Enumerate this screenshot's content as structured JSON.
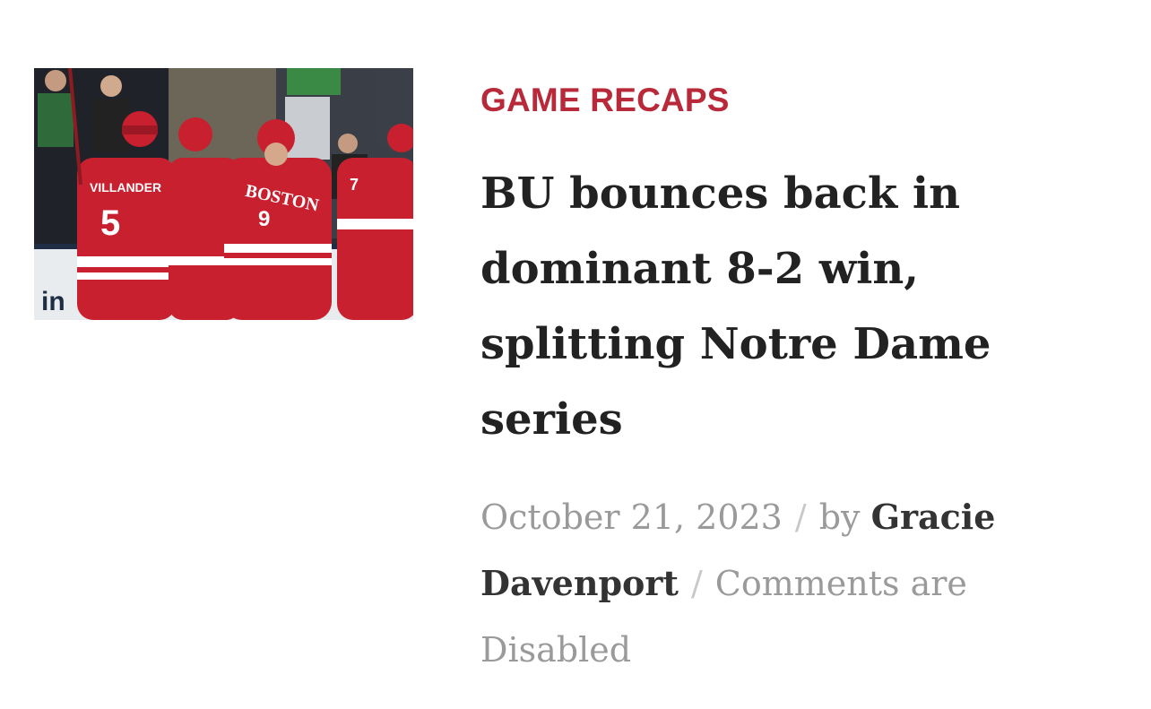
{
  "article": {
    "category": "GAME RECAPS",
    "title": "BU bounces back in dominant 8-2 win, splitting Notre Dame series",
    "date": "October 21, 2023",
    "separator": "/",
    "by_label": "by",
    "author": "Gracie Davenport",
    "comments_status": "Comments are Disabled",
    "image": {
      "jersey_name_left": "VILLANDER",
      "jersey_number_left": "5",
      "jersey_text_center": "BOSTON",
      "jersey_number_center": "9",
      "jersey_number_right": "7",
      "board_text": "in"
    }
  },
  "colors": {
    "accent": "#b8293a",
    "title": "#222222",
    "meta": "#9a9a9a",
    "author": "#333333"
  }
}
